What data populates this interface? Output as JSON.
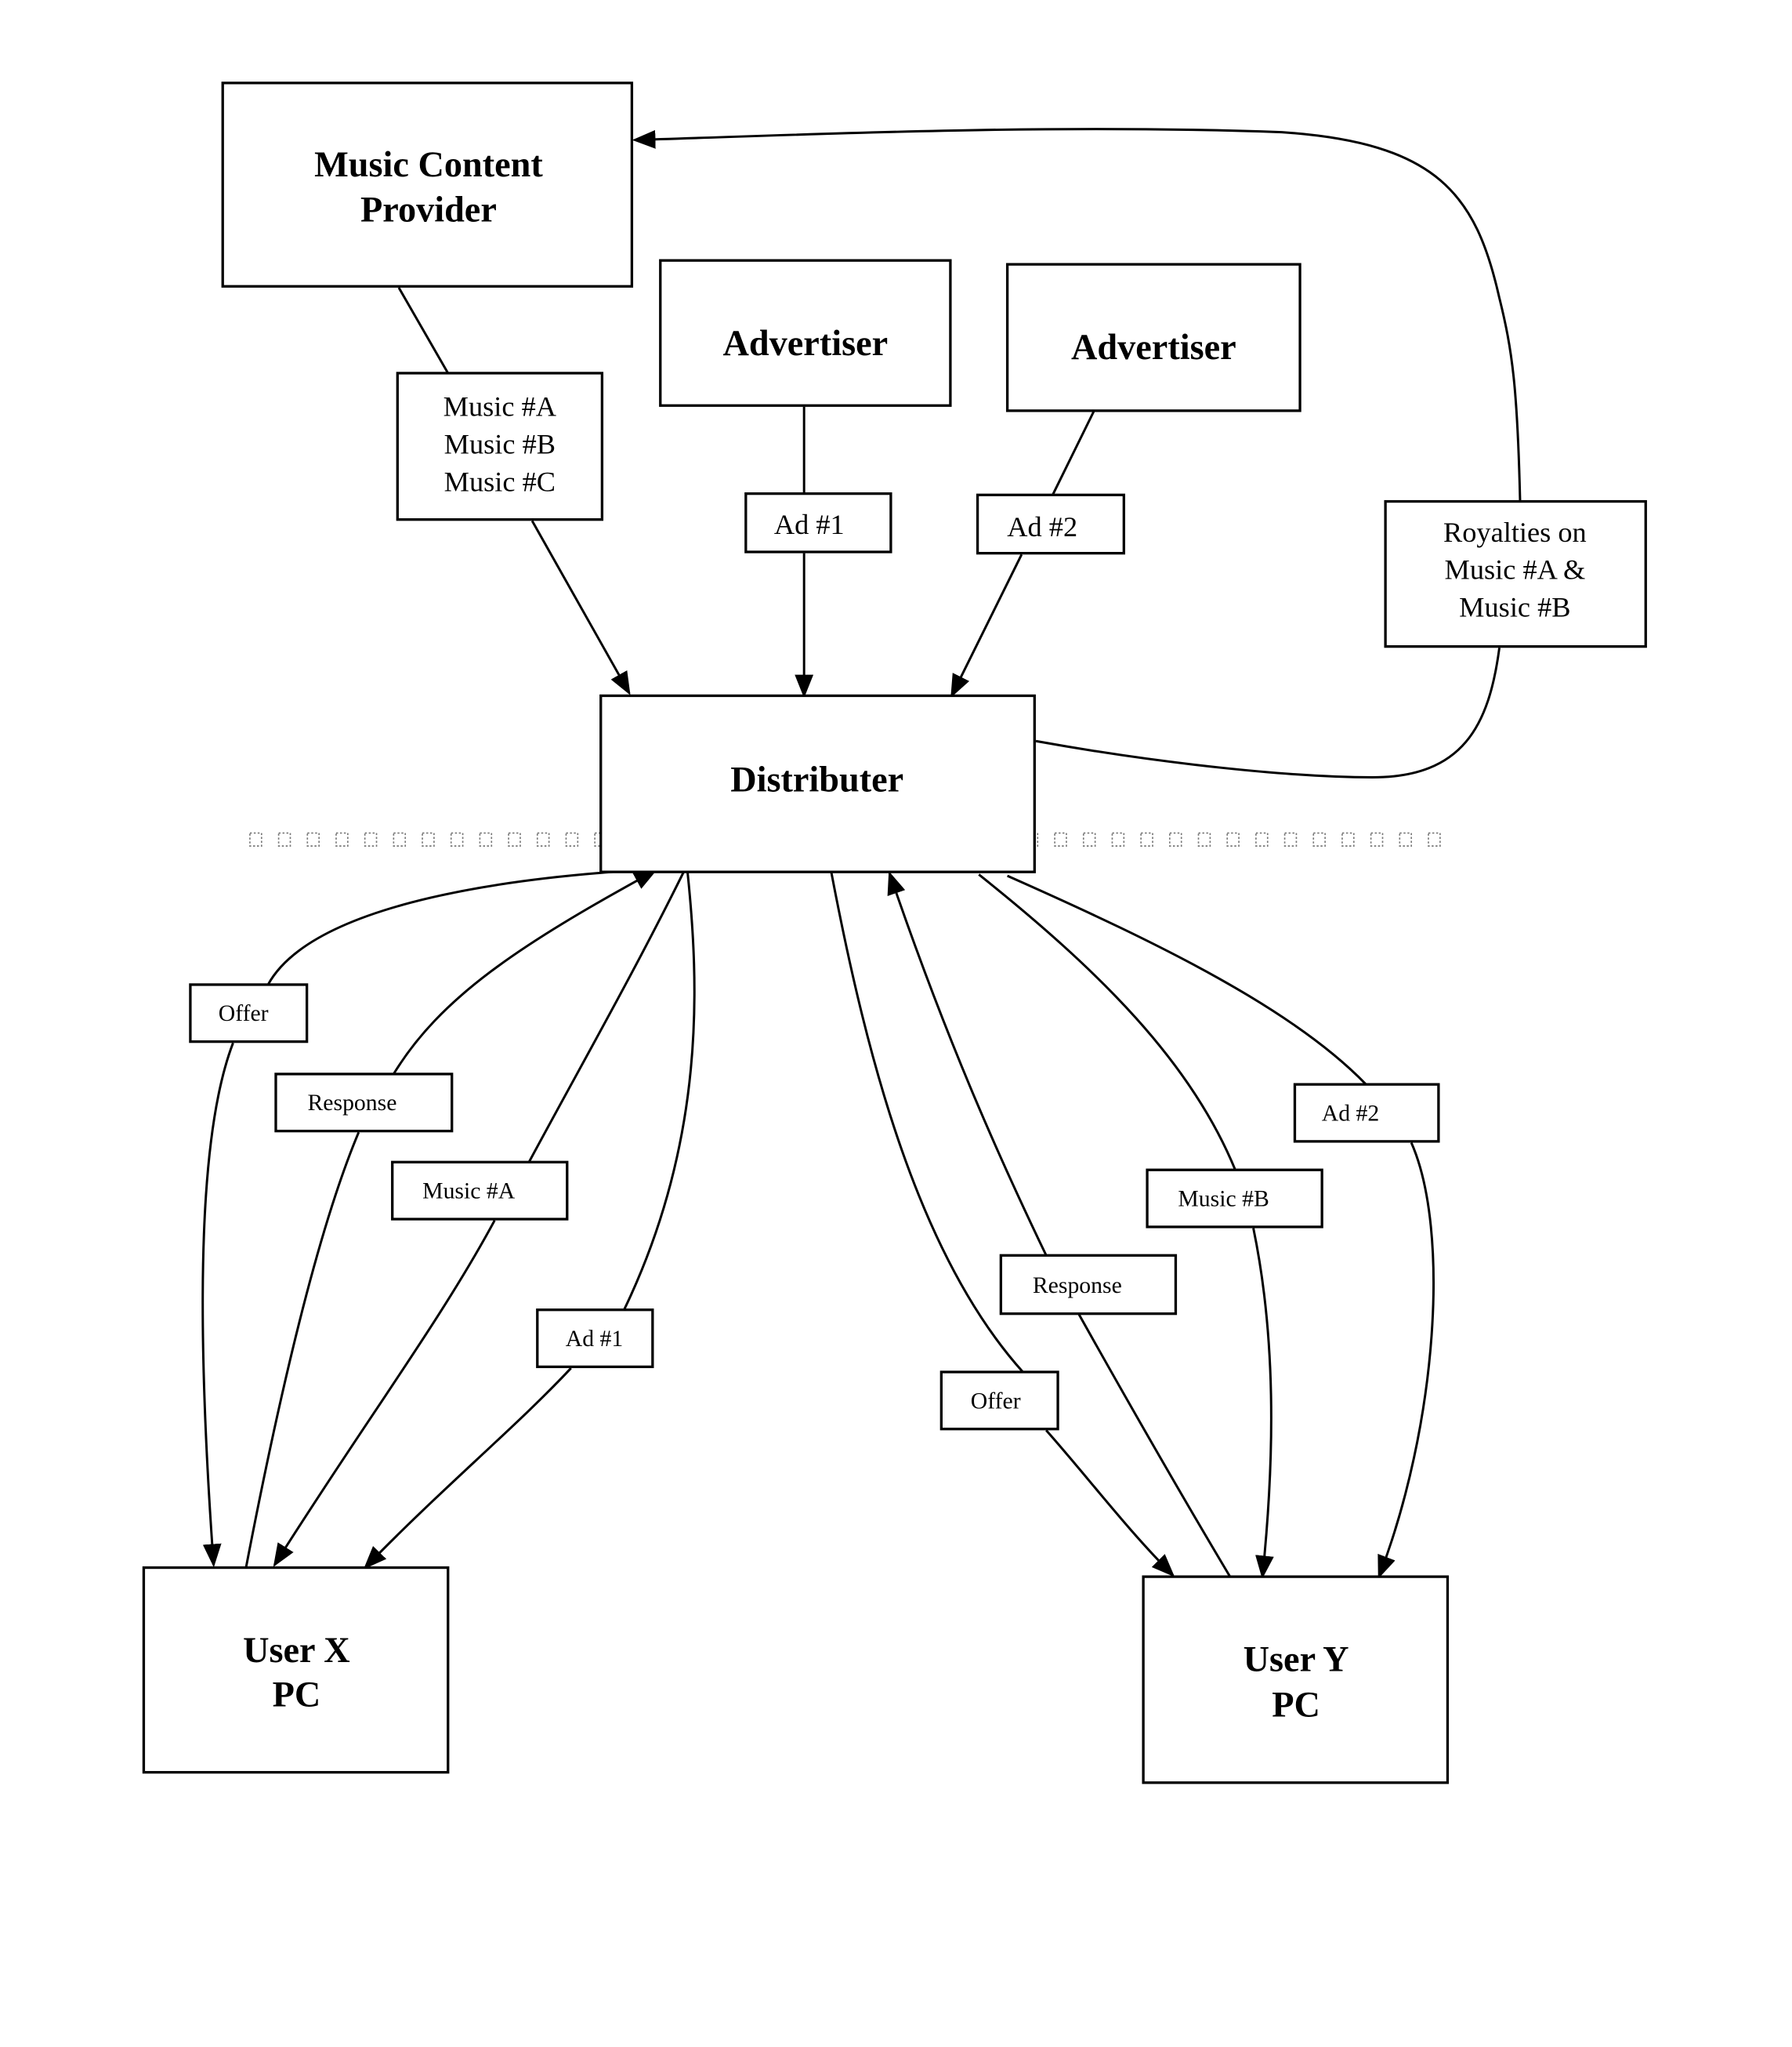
{
  "diagram": {
    "nodes": {
      "provider": {
        "lines": [
          "Music Content",
          "Provider"
        ]
      },
      "advertiser1": {
        "lines": [
          "Advertiser"
        ]
      },
      "advertiser2": {
        "lines": [
          "Advertiser"
        ]
      },
      "distributer": {
        "lines": [
          "Distributer"
        ]
      },
      "user_x": {
        "lines": [
          "User X",
          "PC"
        ]
      },
      "user_y": {
        "lines": [
          "User Y",
          "PC"
        ]
      }
    },
    "labels": {
      "music_list": [
        "Music #A",
        "Music #B",
        "Music #C"
      ],
      "ad1_top": "Ad #1",
      "ad2_top": "Ad #2",
      "royalties": [
        "Royalties on",
        "Music #A &",
        "Music #B"
      ],
      "x_offer": "Offer",
      "x_response": "Response",
      "x_music": "Music #A",
      "x_ad": "Ad #1",
      "y_offer": "Offer",
      "y_response": "Response",
      "y_music": "Music #B",
      "y_ad": "Ad #2"
    },
    "edges": [
      {
        "from": "provider",
        "to": "distributer",
        "label": "music_list"
      },
      {
        "from": "advertiser1",
        "to": "distributer",
        "label": "ad1_top"
      },
      {
        "from": "advertiser2",
        "to": "distributer",
        "label": "ad2_top"
      },
      {
        "from": "distributer",
        "to": "provider",
        "label": "royalties"
      },
      {
        "from": "distributer",
        "to": "user_x",
        "label": "x_offer"
      },
      {
        "from": "user_x",
        "to": "distributer",
        "label": "x_response"
      },
      {
        "from": "distributer",
        "to": "user_x",
        "label": "x_music"
      },
      {
        "from": "distributer",
        "to": "user_x",
        "label": "x_ad"
      },
      {
        "from": "distributer",
        "to": "user_y",
        "label": "y_offer"
      },
      {
        "from": "user_y",
        "to": "distributer",
        "label": "y_response"
      },
      {
        "from": "distributer",
        "to": "user_y",
        "label": "y_music"
      },
      {
        "from": "distributer",
        "to": "user_y",
        "label": "y_ad"
      }
    ]
  }
}
